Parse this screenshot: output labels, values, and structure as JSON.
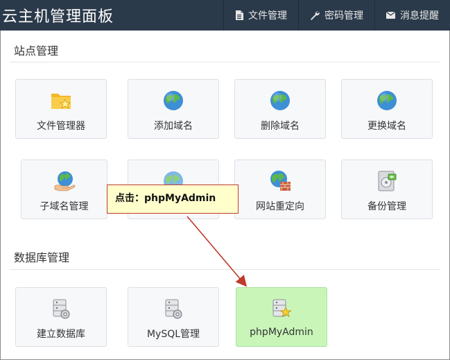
{
  "header": {
    "title": "云主机管理面板",
    "nav": [
      {
        "label": "文件管理",
        "icon": "document-icon"
      },
      {
        "label": "密码管理",
        "icon": "wrench-icon"
      },
      {
        "label": "消息提醒",
        "icon": "envelope-icon"
      }
    ]
  },
  "sections": {
    "site": {
      "title": "站点管理",
      "tiles": [
        {
          "label": "文件管理器",
          "icon": "folder-star-icon"
        },
        {
          "label": "添加域名",
          "icon": "globe-icon"
        },
        {
          "label": "删除域名",
          "icon": "globe-icon"
        },
        {
          "label": "更换域名",
          "icon": "globe-icon"
        },
        {
          "label": "子域名管理",
          "icon": "globe-hand-icon"
        },
        {
          "label": "",
          "icon": "globe-icon"
        },
        {
          "label": "网站重定向",
          "icon": "globe-wall-icon"
        },
        {
          "label": "备份管理",
          "icon": "disk-backup-icon"
        }
      ]
    },
    "database": {
      "title": "数据库管理",
      "tiles": [
        {
          "label": "建立数据库",
          "icon": "database-gear-icon"
        },
        {
          "label": "MySQL管理",
          "icon": "database-gear-icon"
        },
        {
          "label": "phpMyAdmin",
          "icon": "database-star-icon"
        }
      ]
    }
  },
  "annotation": {
    "text": "点击：phpMyAdmin",
    "border_color": "#c0392b",
    "bg_color": "#ffffcc"
  },
  "colors": {
    "topbar": "#2b3a4a",
    "tile_bg": "#f7f8fa",
    "highlight": "#c9f5b9"
  }
}
